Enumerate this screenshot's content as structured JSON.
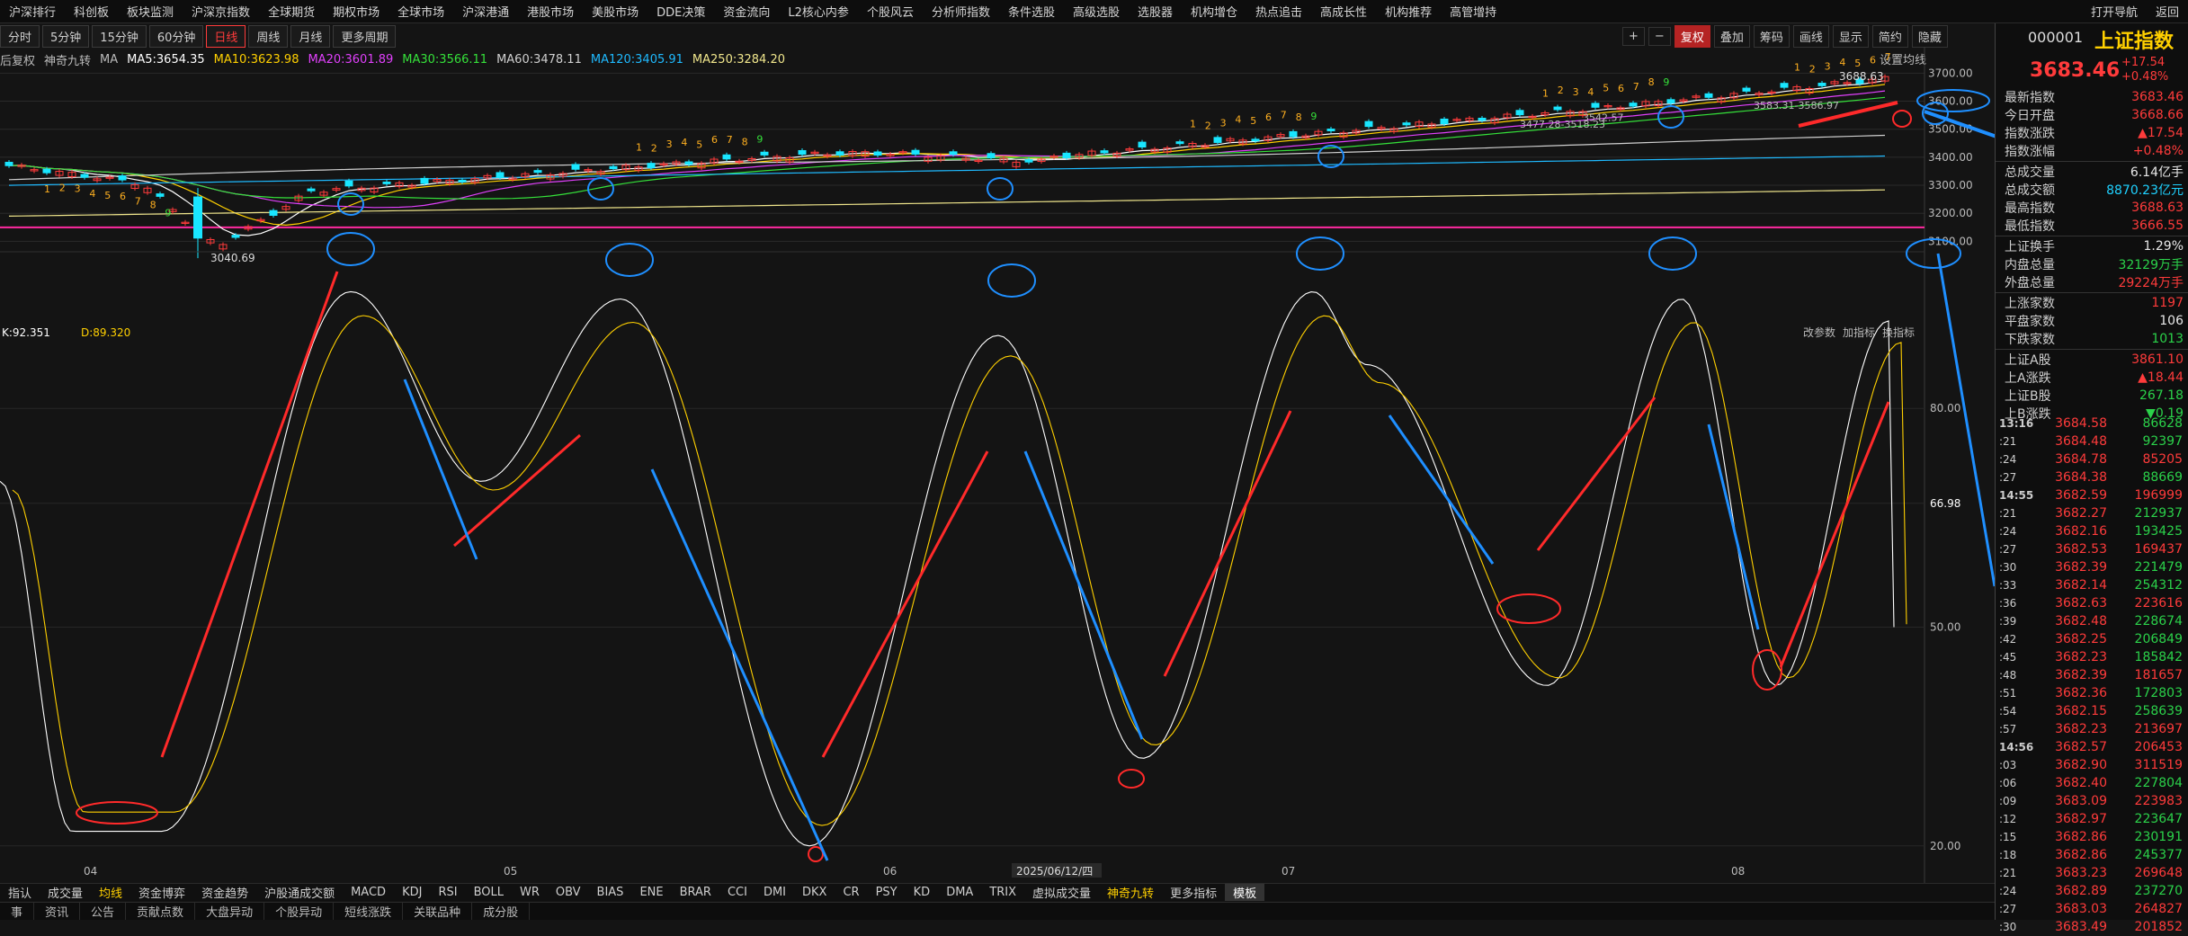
{
  "menu": [
    "沪深排行",
    "科创板",
    "板块监测",
    "沪深京指数",
    "全球期货",
    "期权市场",
    "全球市场",
    "沪深港通",
    "港股市场",
    "美股市场",
    "DDE决策",
    "资金流向",
    "L2核心内参",
    "个股风云",
    "分析师指数",
    "条件选股",
    "高级选股",
    "选股器",
    "机构增仓",
    "热点追击",
    "高成长性",
    "机构推荐",
    "高管增持"
  ],
  "menu_right": [
    "打开导航",
    "返回"
  ],
  "periods": [
    "分时",
    "5分钟",
    "15分钟",
    "60分钟",
    "日线",
    "周线",
    "月线",
    "更多周期"
  ],
  "active_period": "日线",
  "toolbar": {
    "plus": "+",
    "minus": "−",
    "fq": "复权",
    "overlay": "叠加",
    "chips": "筹码",
    "draw": "画线",
    "show": "显示",
    "simple": "简约",
    "hide": "隐藏"
  },
  "ma_line": {
    "prefix": "后复权",
    "indicator": "神奇九转",
    "ma_label": "MA",
    "ma5": "MA5:3654.35",
    "ma10": "MA10:3623.98",
    "ma20": "MA20:3601.89",
    "ma30": "MA30:3566.11",
    "ma60": "MA60:3478.11",
    "ma120": "MA120:3405.91",
    "ma250": "MA250:3284.20",
    "settings": "设置均线"
  },
  "colors": {
    "ma5": "#ffffff",
    "ma10": "#ffd000",
    "ma20": "#e040fb",
    "ma30": "#35e13a",
    "ma60": "#cfcfcf",
    "ma120": "#1fbaff",
    "ma250": "#f0e68c",
    "up": "#ff3b3b",
    "down": "#19e6ff",
    "annot_up": "#ff2a2a",
    "annot_down": "#1f8fff"
  },
  "chart_data": [
    {
      "type": "candlestick",
      "y_ticks": [
        "3700.00",
        "3600.00",
        "3500.00",
        "3400.00",
        "3300.00",
        "3200.00",
        "3100.00"
      ],
      "ylim": [
        3050,
        3730
      ],
      "price_labels": {
        "high": "3688.63",
        "low": "3040.69",
        "box1": "3583.31-3586.97",
        "box2": "3477.28-3518.23",
        "box3": "3542.57"
      },
      "nine_counts": [
        "1",
        "2",
        "3",
        "4",
        "5",
        "6",
        "7",
        "8",
        "9"
      ]
    },
    {
      "type": "line",
      "series": [
        {
          "name": "K",
          "value_label": "K:92.351"
        },
        {
          "name": "D",
          "value_label": "D:89.320"
        }
      ],
      "y_ticks": [
        "80.00",
        "66.98",
        "50.00",
        "20.00"
      ],
      "ylim": [
        18,
        100
      ],
      "x_labels": [
        "04",
        "05",
        "06",
        "07",
        "08"
      ],
      "cursor_date": "2025/06/12/四",
      "panel_buttons": [
        "改参数",
        "加指标",
        "换指标"
      ]
    }
  ],
  "bottom_tabs": [
    "指认",
    "成交量",
    "均线",
    "资金博弈",
    "资金趋势",
    "沪股通成交额",
    "MACD",
    "KDJ",
    "RSI",
    "BOLL",
    "WR",
    "OBV",
    "BIAS",
    "ENE",
    "BRAR",
    "CCI",
    "DMI",
    "DKX",
    "CR",
    "PSY",
    "KD",
    "DMA",
    "TRIX",
    "虚拟成交量",
    "神奇九转",
    "更多指标",
    "模板"
  ],
  "active_bottom": "均线",
  "info_tabs": [
    "事",
    "资讯",
    "公告",
    "贡献点数",
    "大盘异动",
    "个股异动",
    "短线涨跌",
    "关联品种",
    "成分股"
  ],
  "right_panel": {
    "code": "000001",
    "name": "上证指数",
    "price": "3683.46",
    "change": "+17.54",
    "change_pct": "+0.48%",
    "rows": [
      {
        "k": "最新指数",
        "v": "3683.46",
        "c": "red"
      },
      {
        "k": "今日开盘",
        "v": "3668.66",
        "c": "red"
      },
      {
        "k": "指数涨跌",
        "v": "▲17.54",
        "c": "red"
      },
      {
        "k": "指数涨幅",
        "v": "+0.48%",
        "c": "red"
      },
      {
        "k": "总成交量",
        "v": "6.14亿手",
        "c": "white"
      },
      {
        "k": "总成交额",
        "v": "8870.23亿元",
        "c": "cyan"
      },
      {
        "k": "最高指数",
        "v": "3688.63",
        "c": "red"
      },
      {
        "k": "最低指数",
        "v": "3666.55",
        "c": "red"
      },
      {
        "k": "上证换手",
        "v": "1.29%",
        "c": "white"
      },
      {
        "k": "内盘总量",
        "v": "32129万手",
        "c": "green"
      },
      {
        "k": "外盘总量",
        "v": "29224万手",
        "c": "red"
      },
      {
        "k": "上涨家数",
        "v": "1197",
        "c": "red"
      },
      {
        "k": "平盘家数",
        "v": "106",
        "c": "white"
      },
      {
        "k": "下跌家数",
        "v": "1013",
        "c": "green"
      },
      {
        "k": "上证A股",
        "v": "3861.10",
        "c": "red"
      },
      {
        "k": "上A涨跌",
        "v": "▲18.44",
        "c": "red"
      },
      {
        "k": "上证B股",
        "v": "267.18",
        "c": "green"
      },
      {
        "k": "上B涨跌",
        "v": "▼0.19",
        "c": "green"
      }
    ],
    "ticks": [
      {
        "t": "13:16",
        "p": "3684.58",
        "v": "86628",
        "c": "green",
        "g": true
      },
      {
        "t": ":21",
        "p": "3684.48",
        "v": "92397",
        "c": "green"
      },
      {
        "t": ":24",
        "p": "3684.78",
        "v": "85205",
        "c": "red"
      },
      {
        "t": ":27",
        "p": "3684.38",
        "v": "88669",
        "c": "green"
      },
      {
        "t": "14:55",
        "p": "3682.59",
        "v": "196999",
        "c": "red",
        "g": true
      },
      {
        "t": ":21",
        "p": "3682.27",
        "v": "212937",
        "c": "green"
      },
      {
        "t": ":24",
        "p": "3682.16",
        "v": "193425",
        "c": "green"
      },
      {
        "t": ":27",
        "p": "3682.53",
        "v": "169437",
        "c": "red"
      },
      {
        "t": ":30",
        "p": "3682.39",
        "v": "221479",
        "c": "green"
      },
      {
        "t": ":33",
        "p": "3682.14",
        "v": "254312",
        "c": "green"
      },
      {
        "t": ":36",
        "p": "3682.63",
        "v": "223616",
        "c": "red"
      },
      {
        "t": ":39",
        "p": "3682.48",
        "v": "228674",
        "c": "green"
      },
      {
        "t": ":42",
        "p": "3682.25",
        "v": "206849",
        "c": "green"
      },
      {
        "t": ":45",
        "p": "3682.23",
        "v": "185842",
        "c": "green"
      },
      {
        "t": ":48",
        "p": "3682.39",
        "v": "181657",
        "c": "red"
      },
      {
        "t": ":51",
        "p": "3682.36",
        "v": "172803",
        "c": "green"
      },
      {
        "t": ":54",
        "p": "3682.15",
        "v": "258639",
        "c": "green"
      },
      {
        "t": ":57",
        "p": "3682.23",
        "v": "213697",
        "c": "red"
      },
      {
        "t": "14:56",
        "p": "3682.57",
        "v": "206453",
        "c": "red",
        "g": true
      },
      {
        "t": ":03",
        "p": "3682.90",
        "v": "311519",
        "c": "red"
      },
      {
        "t": ":06",
        "p": "3682.40",
        "v": "227804",
        "c": "green"
      },
      {
        "t": ":09",
        "p": "3683.09",
        "v": "223983",
        "c": "red"
      },
      {
        "t": ":12",
        "p": "3682.97",
        "v": "223647",
        "c": "green"
      },
      {
        "t": ":15",
        "p": "3682.86",
        "v": "230191",
        "c": "green"
      },
      {
        "t": ":18",
        "p": "3682.86",
        "v": "245377",
        "c": "green"
      },
      {
        "t": ":21",
        "p": "3683.23",
        "v": "269648",
        "c": "red"
      },
      {
        "t": ":24",
        "p": "3682.89",
        "v": "237270",
        "c": "green"
      },
      {
        "t": ":27",
        "p": "3683.03",
        "v": "264827",
        "c": "red"
      },
      {
        "t": ":30",
        "p": "3683.49",
        "v": "201852",
        "c": "red"
      }
    ]
  }
}
